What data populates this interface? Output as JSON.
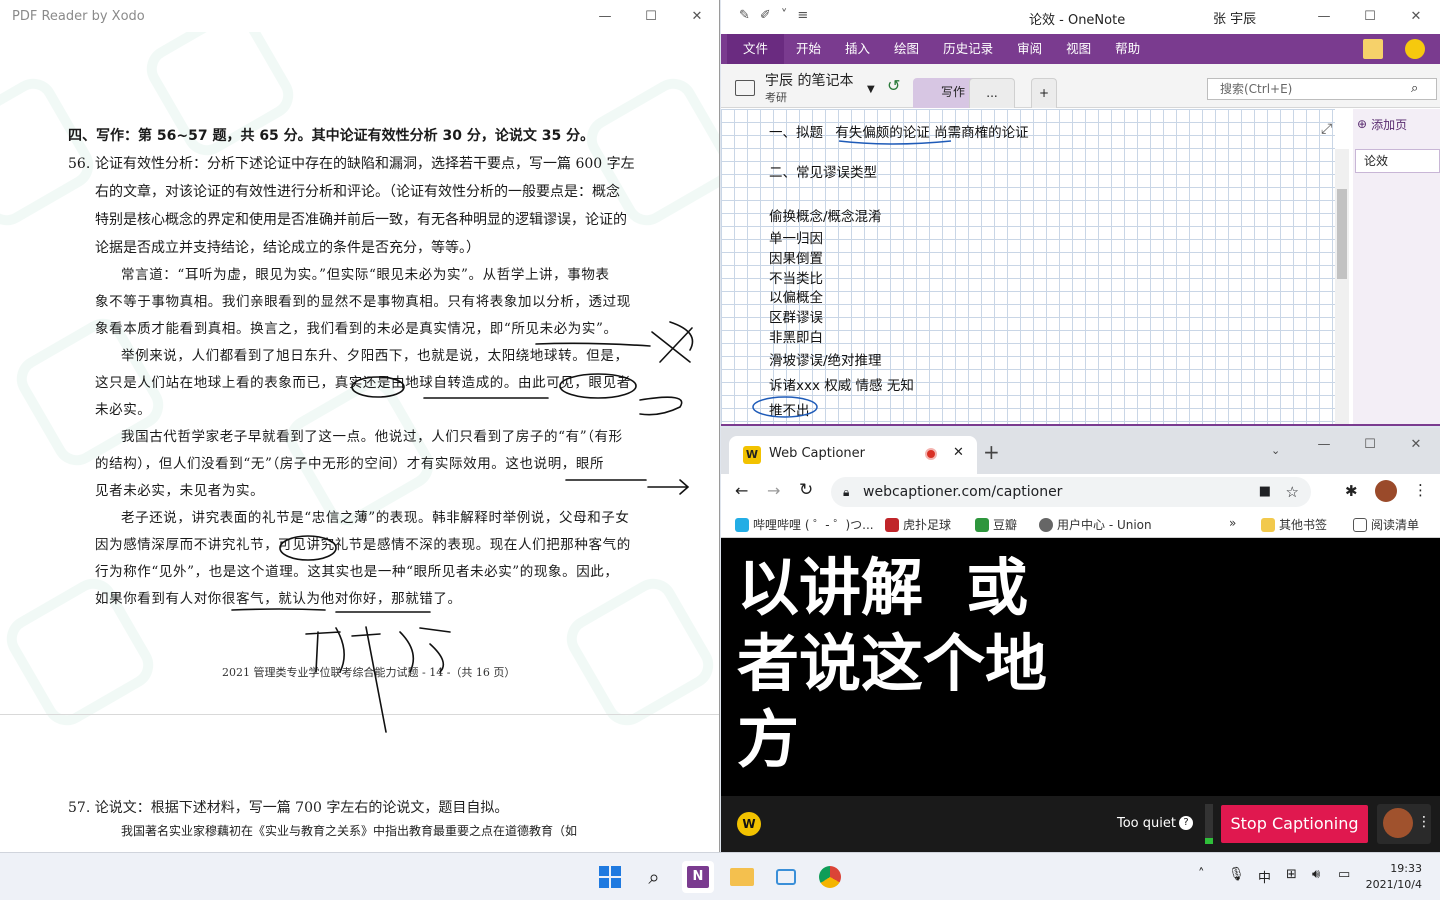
{
  "xodo": {
    "title": "PDF Reader by Xodo",
    "heading": "四、写作：第 56~57 题，共 65 分。其中论证有效性分析 30 分，论说文 35 分。",
    "q56_num": "56.",
    "q56_lines": [
      "论证有效性分析：分析下述论证中存在的缺陷和漏洞，选择若干要点，写一篇 600 字左",
      "右的文章，对该论证的有效性进行分析和评论。（论证有效性分析的一般要点是：概念",
      "特别是核心概念的界定和使用是否准确并前后一致，有无各种明显的逻辑谬误，论证的",
      "论据是否成立并支持结论，结论成立的条件是否充分，等等。）"
    ],
    "passage": [
      "常言道：“耳听为虚，眼见为实。”但实际“眼见未必为实”。从哲学上讲，事物表",
      "象不等于事物真相。我们亲眼看到的显然不是事物真相。只有将表象加以分析，透过现",
      "象看本质才能看到真相。换言之，我们看到的未必是真实情况，即“所见未必为实”。",
      "举例来说，人们都看到了旭日东升、夕阳西下，也就是说，太阳绕地球转。但是，",
      "这只是人们站在地球上看的表象而已，真实还是由地球自转造成的。由此可见，眼见者",
      "未必实。",
      "我国古代哲学家老子早就看到了这一点。他说过，人们只看到了房子的“有”（有形",
      "的结构），但人们没看到“无”（房子中无形的空间）才有实际效用。这也说明，眼所",
      "见者未必实，未见者为实。",
      "老子还说，讲究表面的礼节是“忠信之薄”的表现。韩非解释时举例说，父母和子女",
      "因为感情深厚而不讲究礼节，可见讲究礼节是感情不深的表现。现在人们把那种客气的",
      "行为称作“见外”，也是这个道理。这其实也是一种“眼所见者未必实”的现象。因此，",
      "如果你看到有人对你很客气，就认为他对你好，那就错了。"
    ],
    "footer": "2021 管理类专业学位联考综合能力试题 - 14 -（共 16 页）",
    "q57_line": "57. 论说文：根据下述材料，写一篇 700 字左右的论说文，题目自拟。",
    "q57_text": "我国著名实业家穆藕初在《实业与教育之关系》中指出教育最重要之点在道德教育（如"
  },
  "onenote": {
    "title": "论效  -  OneNote",
    "user": "张 宇辰",
    "ribbon_tabs": [
      "文件",
      "开始",
      "插入",
      "绘图",
      "历史记录",
      "审阅",
      "视图",
      "帮助"
    ],
    "notebook_name": "宇辰 的笔记本",
    "notebook_sub": "考研",
    "section_tab": "写作",
    "more_tab": "...",
    "search_placeholder": "搜索(Ctrl+E)",
    "add_page": "添加页",
    "page_item": "论效",
    "notes": {
      "line1a": "一、拟题",
      "line1b": "有失偏颇的论证",
      "line1c": "尚需商榷的论证",
      "line2": "二、常见谬误类型",
      "items": [
        "偷换概念/概念混淆",
        "单一归因",
        "因果倒置",
        "不当类比",
        "以偏概全",
        "区群谬误",
        "非黑即白"
      ],
      "slope": "滑坡谬误/绝对推理",
      "appeal": "诉诸xxx  权威  情感 无知",
      "last": "推不出"
    },
    "accent": "#7a3b8f"
  },
  "chrome": {
    "tab_title": "Web Captioner",
    "url": "webcaptioner.com/captioner",
    "bookmarks": [
      "哔哩哔哩 ( ゜- ゜)つ...",
      "虎扑足球",
      "豆瓣",
      "用户中心 - Union",
      "其他书签",
      "阅读清单"
    ],
    "caption": "以讲解  或\n者说这个地\n方",
    "too_quiet": "Too quiet",
    "stop_label": "Stop Captioning",
    "stop_color": "#e0184f"
  },
  "taskbar": {
    "ime": "中",
    "time": "19:33",
    "date": "2021/10/4"
  }
}
